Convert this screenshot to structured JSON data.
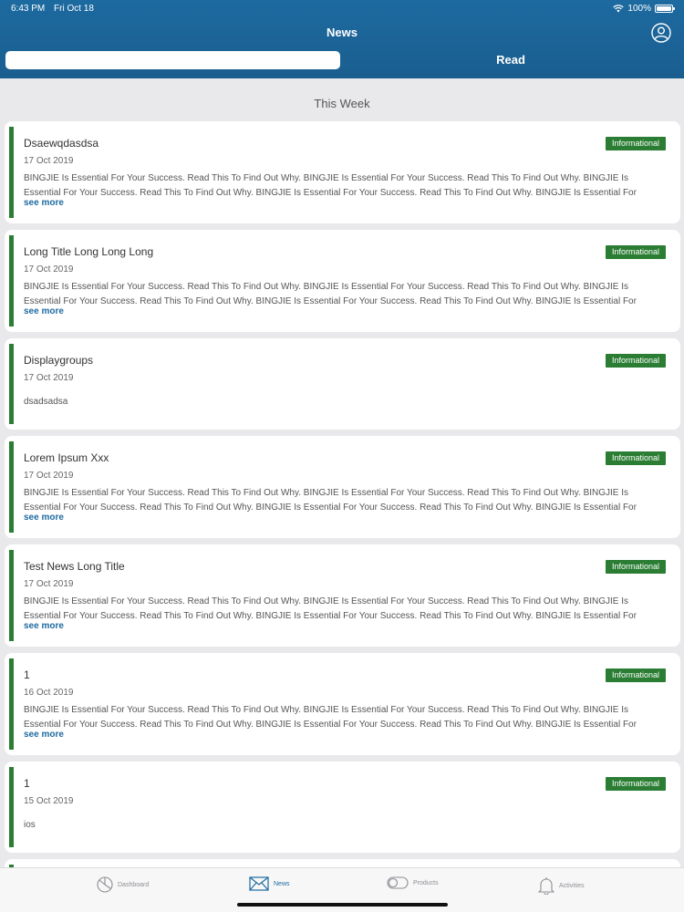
{
  "status": {
    "time": "6:43 PM",
    "date": "Fri Oct 18",
    "battery": "100%"
  },
  "nav": {
    "title": "News",
    "segments": [
      "",
      "Read"
    ]
  },
  "section_title": "This Week",
  "badge_color": "#2a7d33",
  "accent": "#1d6aa0",
  "cards": [
    {
      "title": "Dsaewqdasdsa",
      "badge": "Informational",
      "date": "17 Oct 2019",
      "body": "BINGJIE Is Essential For Your Success. Read This To Find Out Why. BINGJIE Is Essential For Your Success. Read This To Find Out Why. BINGJIE Is Essential For Your Success. Read This To Find Out Why. BINGJIE Is Essential For Your Success. Read This To Find Out Why. BINGJIE Is Essential For",
      "more": "see more"
    },
    {
      "title": "Long Title Long Long Long",
      "badge": "Informational",
      "date": "17 Oct 2019",
      "body": "BINGJIE Is Essential For Your Success. Read This To Find Out Why. BINGJIE Is Essential For Your Success. Read This To Find Out Why. BINGJIE Is Essential For Your Success. Read This To Find Out Why. BINGJIE Is Essential For Your Success. Read This To Find Out Why. BINGJIE Is Essential For",
      "more": "see more"
    },
    {
      "title": "Displaygroups",
      "badge": "Informational",
      "date": "17 Oct 2019",
      "body": "dsadsadsa",
      "more": ""
    },
    {
      "title": "Lorem Ipsum Xxx",
      "badge": "Informational",
      "date": "17 Oct 2019",
      "body": "BINGJIE Is Essential For Your Success. Read This To Find Out Why. BINGJIE Is Essential For Your Success. Read This To Find Out Why. BINGJIE Is Essential For Your Success. Read This To Find Out Why. BINGJIE Is Essential For Your Success. Read This To Find Out Why. BINGJIE Is Essential For",
      "more": "see more"
    },
    {
      "title": "Test News Long Title",
      "badge": "Informational",
      "date": "17 Oct 2019",
      "body": "BINGJIE Is Essential For Your Success. Read This To Find Out Why. BINGJIE Is Essential For Your Success. Read This To Find Out Why. BINGJIE Is Essential For Your Success. Read This To Find Out Why. BINGJIE Is Essential For Your Success. Read This To Find Out Why. BINGJIE Is Essential For",
      "more": "see more"
    },
    {
      "title": "1",
      "badge": "Informational",
      "date": "16 Oct 2019",
      "body": "BINGJIE Is Essential For Your Success. Read This To Find Out Why. BINGJIE Is Essential For Your Success. Read This To Find Out Why. BINGJIE Is Essential For Your Success. Read This To Find Out Why. BINGJIE Is Essential For Your Success. Read This To Find Out Why. BINGJIE Is Essential For",
      "more": "see more"
    },
    {
      "title": "1",
      "badge": "Informational",
      "date": "15 Oct 2019",
      "body": "ios",
      "more": ""
    }
  ],
  "tabs": [
    {
      "label": "Dashboard",
      "icon": "dashboard-icon"
    },
    {
      "label": "News",
      "icon": "envelope-icon",
      "active": true
    },
    {
      "label": "Products",
      "icon": "toggle-icon"
    },
    {
      "label": "Activities",
      "icon": "bell-icon"
    }
  ]
}
